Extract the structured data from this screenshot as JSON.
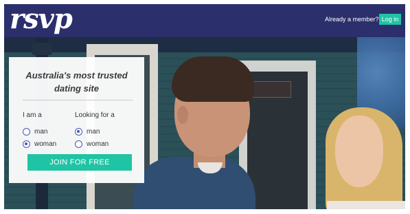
{
  "header": {
    "logo_text": "rsvp",
    "member_prompt": "Already a member?",
    "login_label": "Log in"
  },
  "signup": {
    "tagline_line1": "Australia's most trusted",
    "tagline_line2": "dating site",
    "i_am": {
      "label": "I am a",
      "options": [
        {
          "label": "man",
          "selected": false
        },
        {
          "label": "woman",
          "selected": true
        }
      ]
    },
    "looking_for": {
      "label": "Looking for a",
      "options": [
        {
          "label": "man",
          "selected": true
        },
        {
          "label": "woman",
          "selected": false
        }
      ]
    },
    "join_label": "JOIN FOR FREE"
  },
  "colors": {
    "header_bg": "#2b2f6b",
    "accent_green": "#1fc4a4",
    "radio_blue": "#4b55b5"
  }
}
